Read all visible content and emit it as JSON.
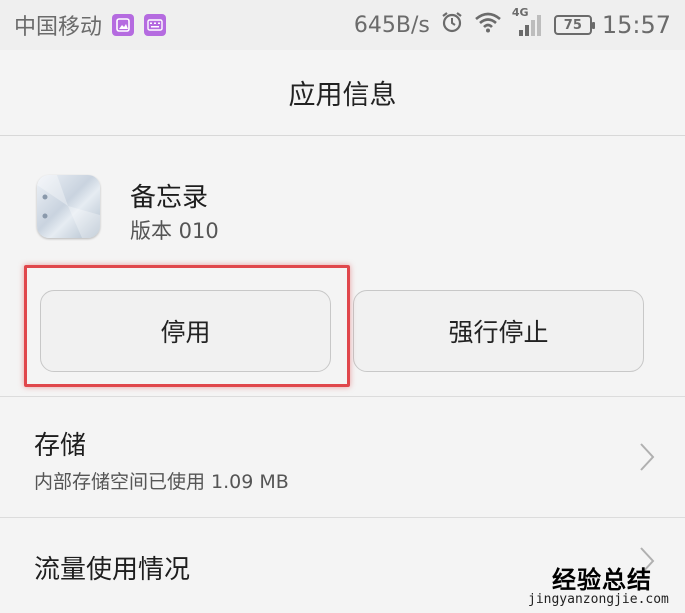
{
  "status_bar": {
    "carrier": "中国移动",
    "network_speed": "645B/s",
    "network_type": "4G",
    "battery": "75",
    "time": "15:57"
  },
  "header": {
    "title": "应用信息"
  },
  "app": {
    "name": "备忘录",
    "version": "版本 010"
  },
  "buttons": {
    "disable": "停用",
    "force_stop": "强行停止"
  },
  "storage": {
    "title": "存储",
    "subtitle": "内部存储空间已使用 1.09 MB"
  },
  "data_usage": {
    "title": "流量使用情况"
  },
  "watermark": {
    "text": "经验总结",
    "url": "jingyanzongjie.com"
  },
  "colors": {
    "highlight": "#e0474c",
    "notification_icon": "#b56be0"
  }
}
